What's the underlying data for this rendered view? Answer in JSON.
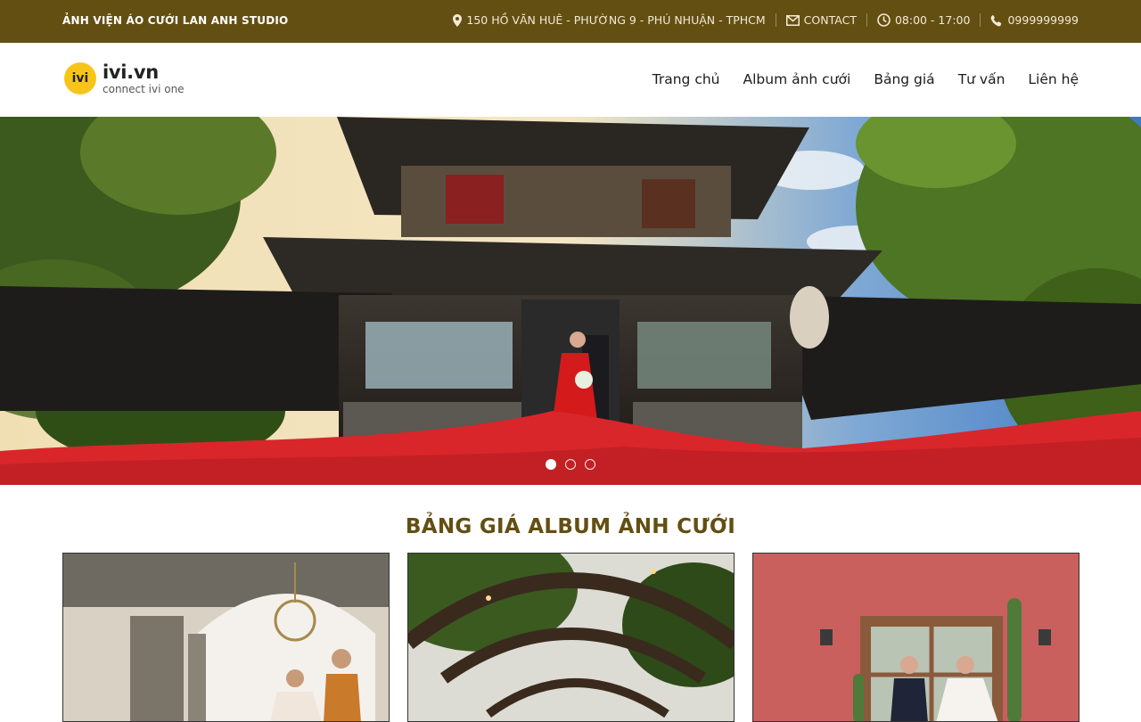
{
  "topbar": {
    "brand": "ẢNH VIỆN ÁO CƯỚI LAN ANH STUDIO",
    "address": "150 HỒ VĂN HUÊ - PHƯỜNG 9 - PHÚ NHUẬN - TPHCM",
    "contact": "CONTACT",
    "hours": "08:00 - 17:00",
    "phone": "0999999999"
  },
  "logo": {
    "mark": "ivi",
    "main": "ivi.vn",
    "sub": "connect ivi one"
  },
  "nav": {
    "items": [
      "Trang chủ",
      "Album ảnh cưới",
      "Bảng giá",
      "Tư vấn",
      "Liên hệ"
    ]
  },
  "hero": {
    "slides": 3,
    "active_slide": 1
  },
  "pricing": {
    "title": "BẢNG GIÁ ALBUM ẢNH CƯỚI"
  },
  "colors": {
    "brand": "#634f12",
    "logo_yellow": "#f7c51a"
  },
  "icons": {
    "address": "map-marker-icon",
    "contact": "envelope-icon",
    "hours": "clock-icon",
    "phone": "phone-icon"
  }
}
